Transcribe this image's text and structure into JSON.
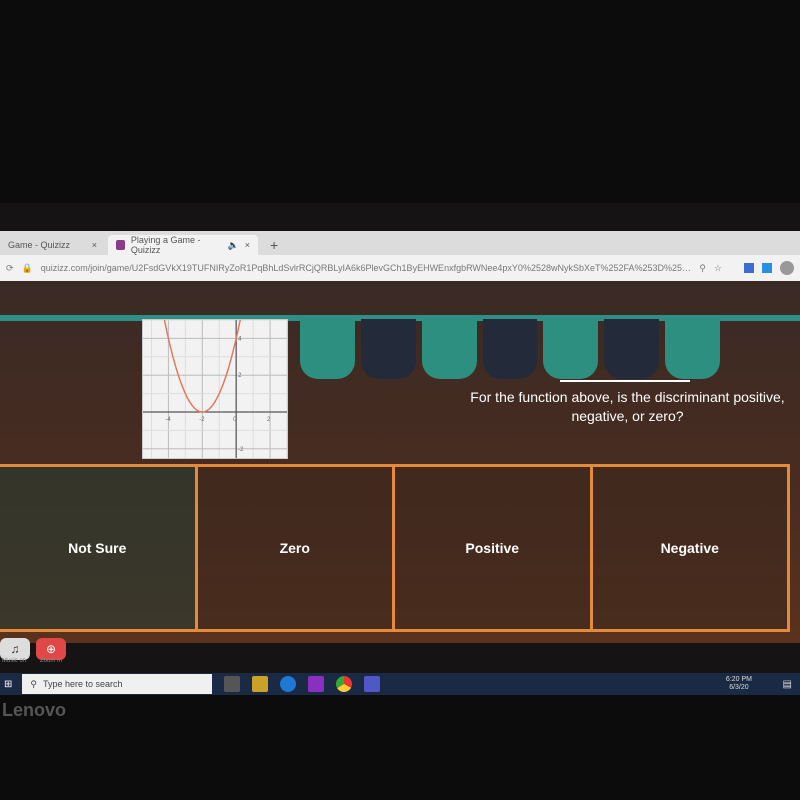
{
  "browser": {
    "tabs": [
      {
        "label": "Game - Quizizz",
        "close": "×"
      },
      {
        "label": "Playing a Game - Quizizz",
        "close": "×",
        "audio": "🔈"
      }
    ],
    "new_tab": "+",
    "url": "quizizz.com/join/game/U2FsdGVkX19TUFNIRyZoR1PqBhLdSvlrRCjQRBLyIA6k6PlevGCh1ByEHWEnxfgbRWNee4pxY0%2528wNykSbXeT%252FA%253D%253D?ga..."
  },
  "question": {
    "blank": "",
    "text": "For the function above, is the discriminant positive, negative, or zero?",
    "graph": {
      "x_ticks": [
        "-4",
        "-2",
        "0",
        "2"
      ],
      "y_ticks": [
        "4",
        "2",
        "-2"
      ],
      "curve_color": "#e07a5f"
    }
  },
  "options": [
    "Not Sure",
    "Zero",
    "Positive",
    "Negative"
  ],
  "controls": {
    "music_label": "Music on",
    "zoom_label": "Zoom In"
  },
  "taskbar": {
    "search_placeholder": "Type here to search",
    "time": "6:20 PM",
    "date": "6/3/20"
  },
  "brand": "Lenovo"
}
